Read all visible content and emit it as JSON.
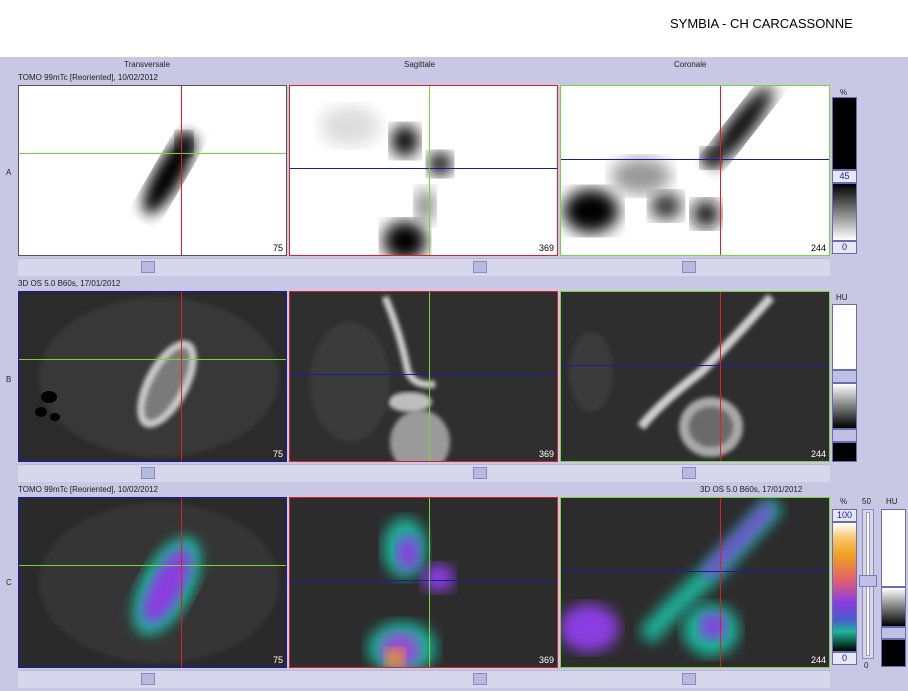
{
  "header": {
    "site": "SYMBIA - CH CARCASSONNE"
  },
  "columns": [
    "Transversale",
    "Sagittale",
    "Coronale"
  ],
  "rows": [
    {
      "letter": "A",
      "series": "TOMO 99mTc [Reoriented], 10/02/2012",
      "series_right": ""
    },
    {
      "letter": "B",
      "series": "3D  OS  5.0  B60s, 17/01/2012",
      "series_right": ""
    },
    {
      "letter": "C",
      "series": "TOMO 99mTc [Reoriented], 10/02/2012",
      "series_right": "3D  OS  5.0  B60s, 17/01/2012"
    }
  ],
  "slices": [
    "75",
    "369",
    "244"
  ],
  "scales": {
    "a": {
      "unit": "%",
      "top_value": "45",
      "bottom_value": "0"
    },
    "b": {
      "unit": "HU"
    },
    "c": {
      "unit": "%",
      "top_value": "100",
      "bottom_value": "0",
      "mid_value": "50",
      "unit2": "HU",
      "low_value": "0"
    }
  },
  "colors": {
    "red": "#e02020",
    "green": "#7ad33a",
    "blue": "#1a1aa8",
    "background": "#c8c8e4"
  }
}
